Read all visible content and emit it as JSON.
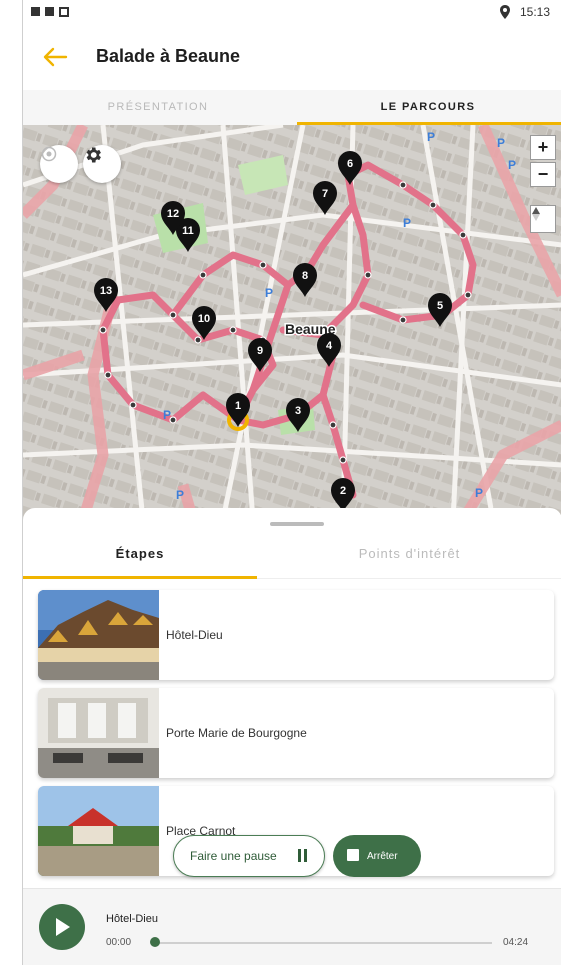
{
  "status_bar": {
    "time": "15:13"
  },
  "app_bar": {
    "title": "Balade à Beaune"
  },
  "tabs": [
    {
      "label": "PRÉSENTATION",
      "active": false
    },
    {
      "label": "LE PARCOURS",
      "active": true
    }
  ],
  "map": {
    "center_label": "Beaune",
    "route_color": "#e2728a",
    "zoom_in": "+",
    "zoom_out": "−",
    "markers": [
      "1",
      "2",
      "3",
      "4",
      "5",
      "6",
      "7",
      "8",
      "9",
      "10",
      "11",
      "12",
      "13"
    ]
  },
  "subtabs": [
    {
      "label": "Étapes",
      "active": true
    },
    {
      "label": "Points d'intérêt",
      "active": false
    }
  ],
  "steps": [
    {
      "label": "Hôtel-Dieu"
    },
    {
      "label": "Porte Marie de Bourgogne"
    },
    {
      "label": "Place Carnot"
    }
  ],
  "actions": {
    "pause_label": "Faire une pause",
    "stop_label": "Arrêter"
  },
  "player": {
    "title": "Hôtel-Dieu",
    "current_time": "00:00",
    "duration": "04:24",
    "progress": 0
  },
  "colors": {
    "accent": "#f0b400",
    "primary": "#3e7048"
  }
}
